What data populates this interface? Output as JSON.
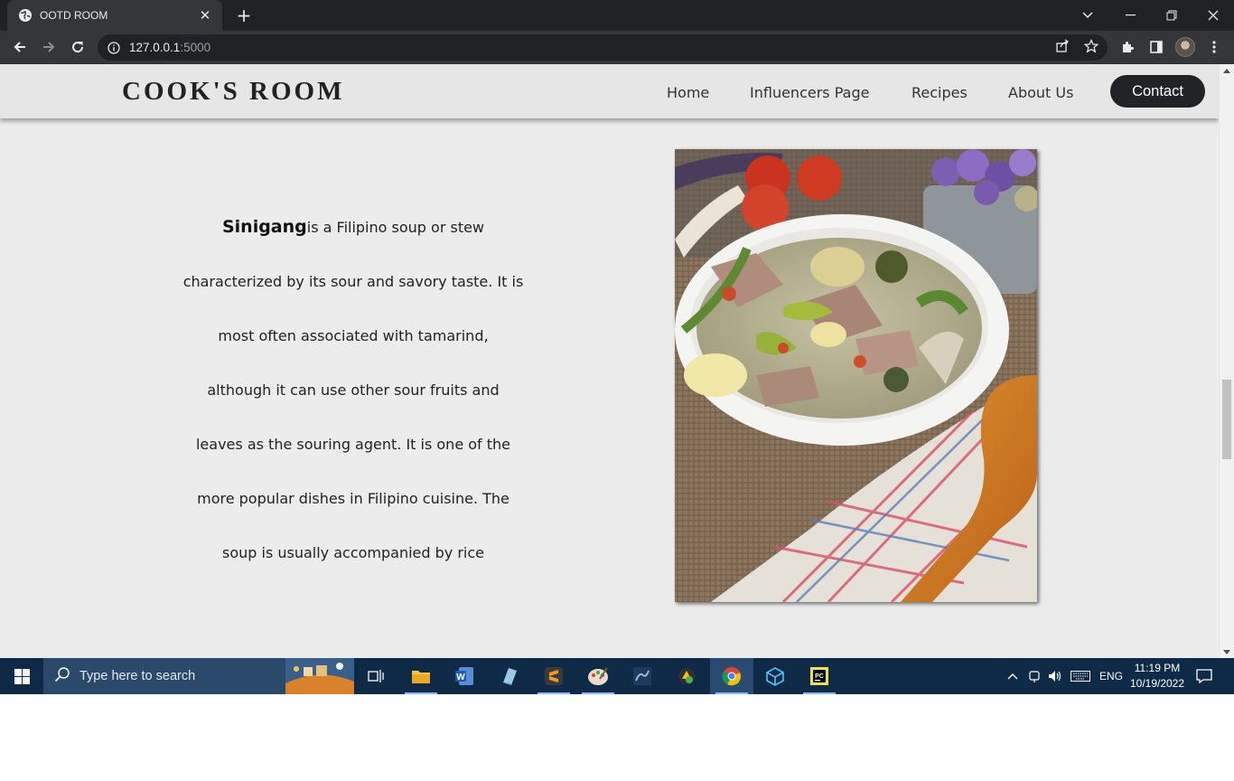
{
  "browser": {
    "tab_title": "OOTD ROOM",
    "url_host": "127.0.0.1",
    "url_port": ":5000"
  },
  "site": {
    "brand": "COOK'S ROOM",
    "nav": [
      "Home",
      "Influencers Page",
      "Recipes",
      "About Us"
    ],
    "contact_label": "Contact"
  },
  "article": {
    "lead": "Sinigang",
    "lines": [
      "is a Filipino soup or stew",
      "characterized by its sour and savory taste. It is",
      "most often associated with tamarind,",
      "although it can use other sour fruits and",
      "leaves as the souring agent. It is one of the",
      "more popular dishes in Filipino cuisine. The",
      "soup is usually accompanied by rice"
    ]
  },
  "taskbar": {
    "search_placeholder": "Type here to search",
    "language": "ENG",
    "time": "11:19 PM",
    "date": "10/19/2022"
  }
}
